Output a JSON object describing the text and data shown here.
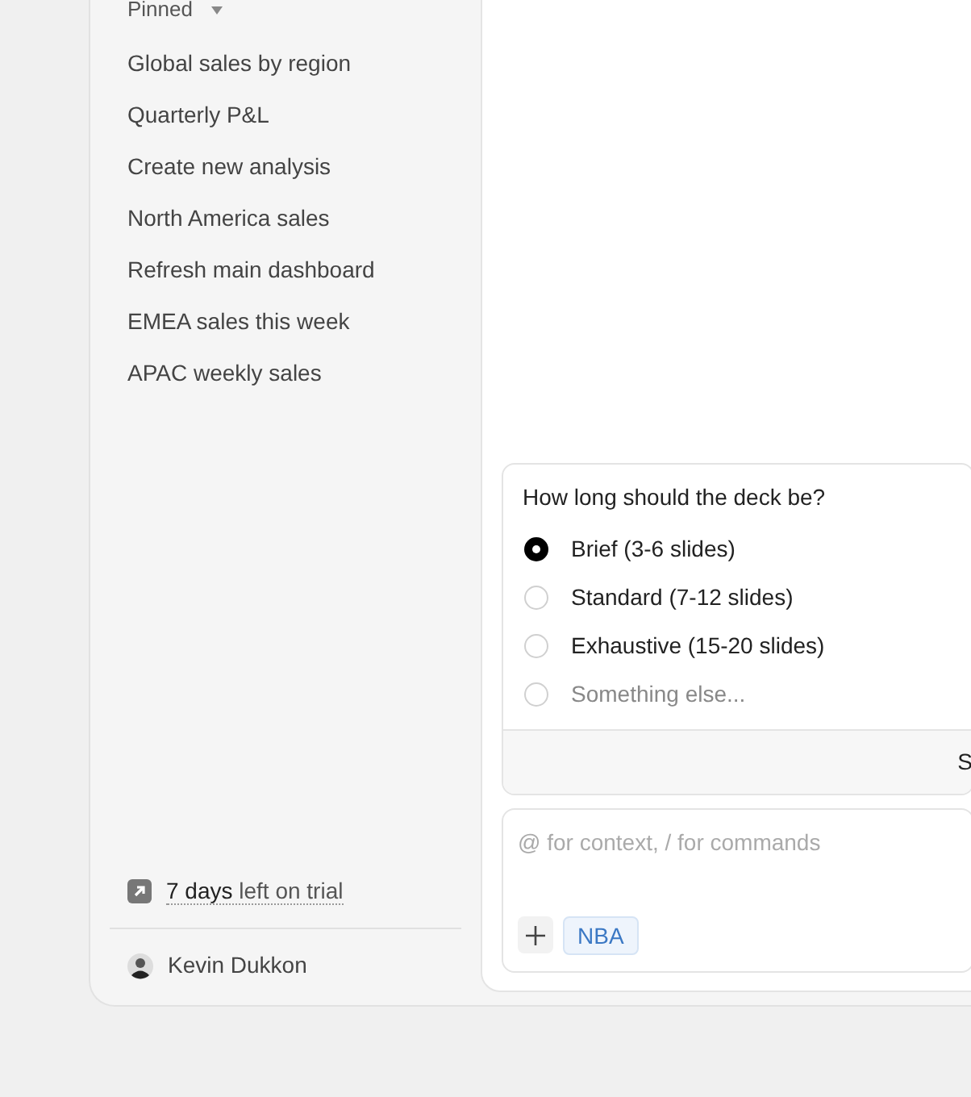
{
  "sidebar": {
    "section": {
      "label": "Pinned",
      "expanded": true
    },
    "items": [
      {
        "label": "Global sales by region"
      },
      {
        "label": "Quarterly P&L"
      },
      {
        "label": "Create new analysis"
      },
      {
        "label": "North America sales"
      },
      {
        "label": "Refresh main dashboard"
      },
      {
        "label": "EMEA sales this week"
      },
      {
        "label": "APAC weekly sales"
      }
    ],
    "trial": "**7 days** left on trial",
    "user": {
      "name": "Kevin Dukkon"
    }
  },
  "question": {
    "prompt": "How long should the deck be?",
    "options": [
      {
        "label": "Brief (3-6 slides)",
        "kind": "option",
        "selected": true
      },
      {
        "label": "Standard (7-12 slides)",
        "kind": "option",
        "selected": false
      },
      {
        "label": "Exhaustive (15-20 slides)",
        "kind": "option",
        "selected": false
      },
      {
        "label": "Something else...",
        "kind": "other",
        "selected": false
      }
    ],
    "submit": "S"
  },
  "composer": {
    "placeholder": "@ for context, / for commands",
    "chips": [
      "NBA"
    ]
  }
}
